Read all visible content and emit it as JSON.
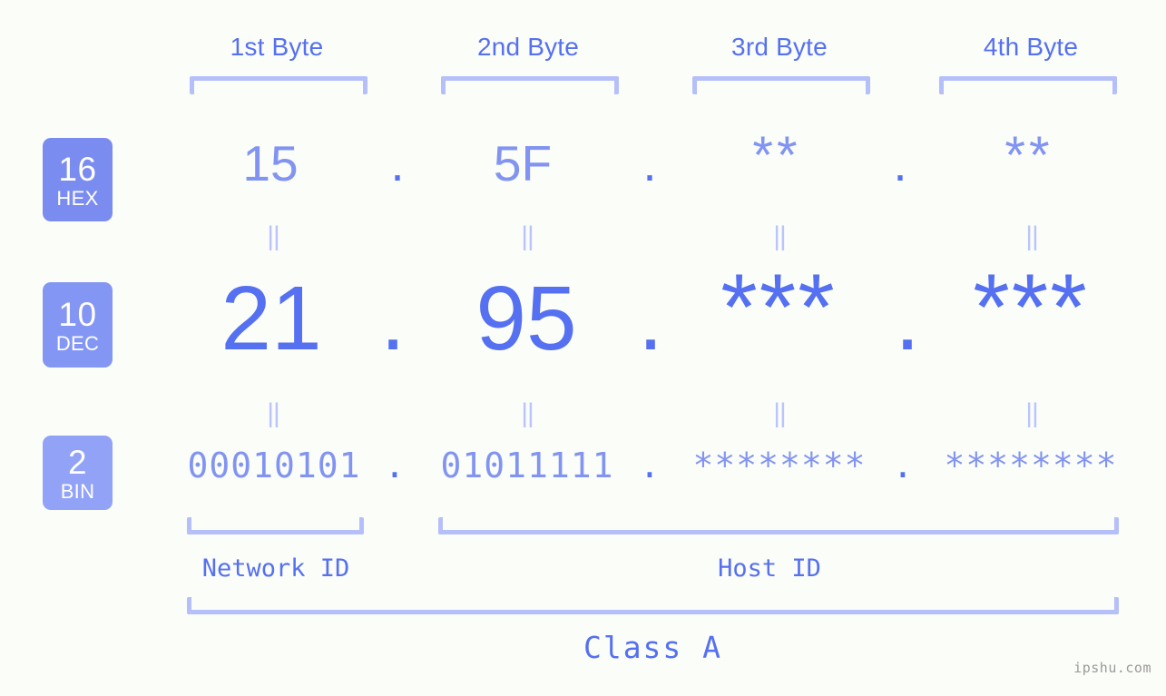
{
  "meta": {
    "watermark": "ipshu.com",
    "accent_color": "#5570f1",
    "accent_light_color": "#8294f2",
    "bracket_color": "#b5bffa",
    "connector_color": "#bcc5fb",
    "background_color": "#fbfdf8"
  },
  "headers": [
    {
      "label": "1st Byte"
    },
    {
      "label": "2nd Byte"
    },
    {
      "label": "3rd Byte"
    },
    {
      "label": "4th Byte"
    }
  ],
  "bases": [
    {
      "id": "hex",
      "number": "16",
      "name": "HEX",
      "color": "#7b8cf0"
    },
    {
      "id": "dec",
      "number": "10",
      "name": "DEC",
      "color": "#8496f3"
    },
    {
      "id": "bin",
      "number": "2",
      "name": "BIN",
      "color": "#92a3f7"
    }
  ],
  "rows": {
    "hex": {
      "base_label": "HEX",
      "values": [
        "15",
        "5F",
        "**",
        "**"
      ],
      "separator": "."
    },
    "dec": {
      "base_label": "DEC",
      "values": [
        "21",
        "95",
        "***",
        "***"
      ],
      "separator": "."
    },
    "bin": {
      "base_label": "BIN",
      "values": [
        "00010101",
        "01011111",
        "********",
        "********"
      ],
      "separator": "."
    }
  },
  "connectors": {
    "symbol": "||",
    "rows": [
      "hex-to-dec",
      "dec-to-bin"
    ]
  },
  "sections": [
    {
      "id": "network-id",
      "label": "Network ID"
    },
    {
      "id": "host-id",
      "label": "Host ID"
    }
  ],
  "class": {
    "label": "Class A"
  }
}
